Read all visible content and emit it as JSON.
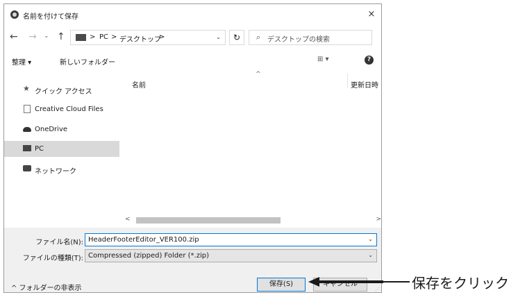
{
  "dialog": {
    "title": "名前を付けて保存",
    "close_symbol": "×"
  },
  "nav": {
    "back_symbol": "←",
    "forward_symbol": "→",
    "recent_symbol": "⌄",
    "up_symbol": "↑",
    "breadcrumb": [
      ">",
      "PC",
      ">",
      "デスクトップ",
      ">"
    ],
    "address_dropdown_symbol": "⌄",
    "refresh_symbol": "↻",
    "search_placeholder": "デスクトップの検索"
  },
  "toolbar": {
    "organize_label": "整理 ▾",
    "new_folder_label": "新しいフォルダー",
    "view_symbol": "⊞ ▾",
    "help_symbol": "?"
  },
  "sidebar": {
    "items": [
      {
        "label": "クイック アクセス",
        "icon": "star-icon"
      },
      {
        "label": "Creative Cloud Files",
        "icon": "document-icon"
      },
      {
        "label": "OneDrive",
        "icon": "cloud-icon"
      },
      {
        "label": "PC",
        "icon": "pc-icon",
        "selected": true
      },
      {
        "label": "ネットワーク",
        "icon": "network-icon"
      }
    ]
  },
  "filelist": {
    "columns": [
      "名前",
      "更新日時"
    ],
    "sort_symbol": "^"
  },
  "scrollbar": {
    "left_symbol": "<",
    "right_symbol": ">"
  },
  "form": {
    "filename_label": "ファイル名(N):",
    "filename_value": "HeaderFooterEditor_VER100.zip",
    "filetype_label": "ファイルの種類(T):",
    "filetype_value": "Compressed (zipped) Folder (*.zip)",
    "dropdown_symbol": "⌄"
  },
  "footer": {
    "hide_folders_label": "^ フォルダーの非表示",
    "save_label": "保存(S)",
    "cancel_label": "キャンセル"
  },
  "annotation": {
    "text": "保存をクリック"
  }
}
